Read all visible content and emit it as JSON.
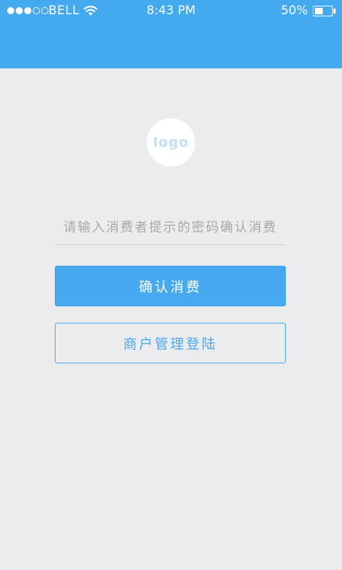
{
  "status_bar": {
    "signal_bars_filled": 3,
    "signal_bars_total": 5,
    "carrier": "BELL",
    "time": "8:43 PM",
    "battery_percent": "50%",
    "battery_level": 0.5
  },
  "logo": {
    "text": "logo"
  },
  "code_field": {
    "value": "",
    "placeholder": "请输入消费者提示的密码确认消费"
  },
  "buttons": {
    "confirm_label": "确认消费",
    "merchant_login_label": "商户管理登陆"
  },
  "colors": {
    "accent": "#44aaf0",
    "background": "#ebecee",
    "placeholder": "#a7a7a9"
  },
  "icons": {
    "signal": "signal-dots-icon",
    "wifi": "wifi-icon",
    "battery": "battery-icon"
  }
}
